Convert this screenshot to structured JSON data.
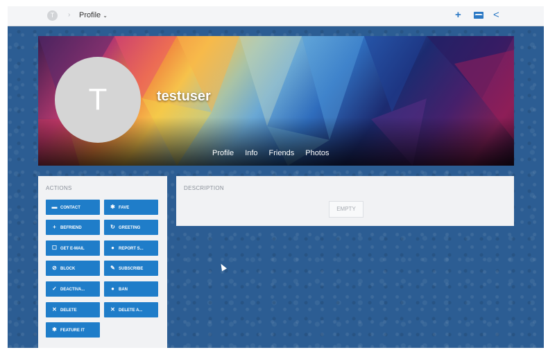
{
  "topbar": {
    "home_letter": "T",
    "separator": "›",
    "menu_label": "Profile",
    "menu_chevron": "⌄",
    "icons": [
      "plus-icon",
      "mail-icon",
      "share-icon"
    ],
    "plus": "+",
    "share": "<"
  },
  "profile": {
    "avatar_letter": "T",
    "username": "testuser",
    "nav": [
      "Profile",
      "Info",
      "Friends",
      "Photos"
    ]
  },
  "actions": {
    "title": "ACTIONS",
    "buttons": [
      {
        "label": "CONTACT",
        "icon": "▬"
      },
      {
        "label": "FAVE",
        "icon": "✱"
      },
      {
        "label": "BEFRIEND",
        "icon": "+"
      },
      {
        "label": "GREETING",
        "icon": "↻"
      },
      {
        "label": "GET E-MAIL",
        "icon": "☐"
      },
      {
        "label": "REPORT S...",
        "icon": "●"
      },
      {
        "label": "BLOCK",
        "icon": "⊘"
      },
      {
        "label": "SUBSCRIBE",
        "icon": "✎"
      },
      {
        "label": "DEACTIVA...",
        "icon": "✓"
      },
      {
        "label": "BAN",
        "icon": "●"
      },
      {
        "label": "DELETE",
        "icon": "✕"
      },
      {
        "label": "DELETE A...",
        "icon": "✕"
      },
      {
        "label": "FEATURE IT",
        "icon": "✱"
      }
    ]
  },
  "description": {
    "title": "DESCRIPTION",
    "empty_label": "EMPTY"
  },
  "colors": {
    "background": "#2c5d93",
    "accent": "#1f7dc9",
    "panel": "#f1f2f4"
  }
}
